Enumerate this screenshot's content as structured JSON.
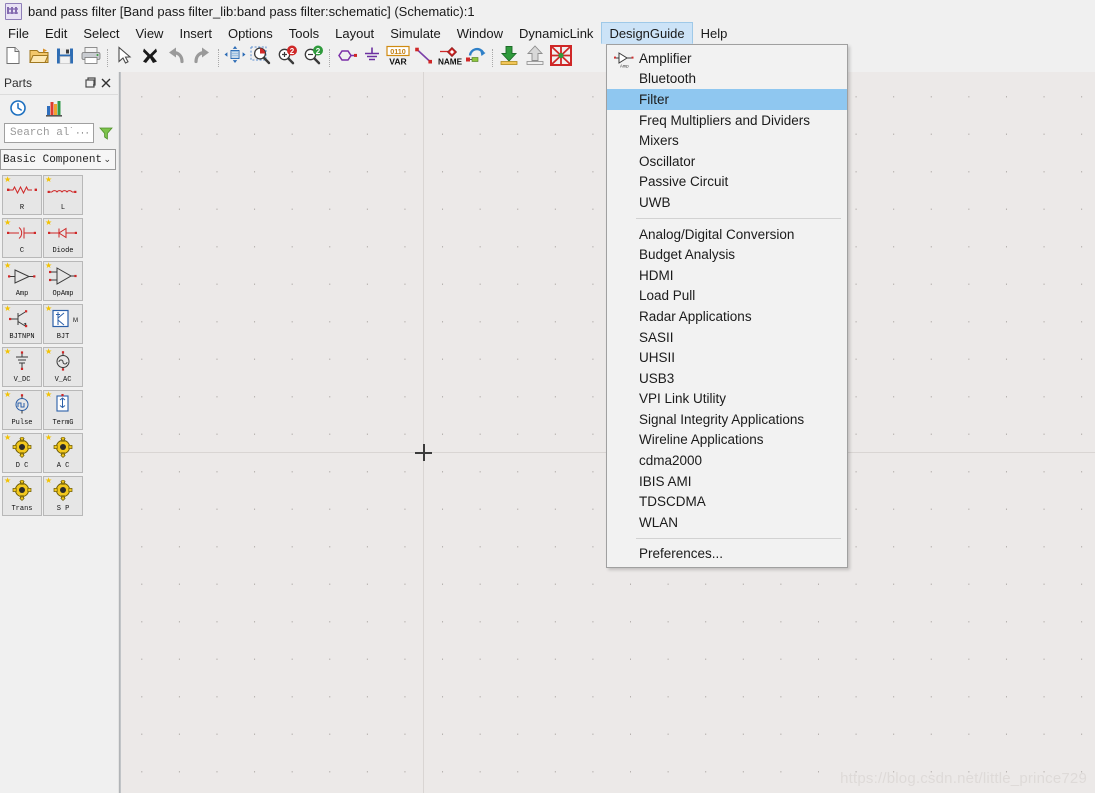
{
  "window": {
    "title": "band pass filter [Band pass filter_lib:band pass filter:schematic] (Schematic):1",
    "app_icon": "schematic-app-icon"
  },
  "menubar": {
    "items": [
      {
        "label": "File",
        "active": false
      },
      {
        "label": "Edit",
        "active": false
      },
      {
        "label": "Select",
        "active": false
      },
      {
        "label": "View",
        "active": false
      },
      {
        "label": "Insert",
        "active": false
      },
      {
        "label": "Options",
        "active": false
      },
      {
        "label": "Tools",
        "active": false
      },
      {
        "label": "Layout",
        "active": false
      },
      {
        "label": "Simulate",
        "active": false
      },
      {
        "label": "Window",
        "active": false
      },
      {
        "label": "DynamicLink",
        "active": false
      },
      {
        "label": "DesignGuide",
        "active": true
      },
      {
        "label": "Help",
        "active": false
      }
    ],
    "highlight_color": "#cce3f7"
  },
  "toolbar": {
    "buttons": [
      {
        "name": "new-file-icon",
        "title": "New"
      },
      {
        "name": "open-folder-icon",
        "title": "Open"
      },
      {
        "name": "save-icon",
        "title": "Save"
      },
      {
        "name": "print-icon",
        "title": "Print"
      },
      {
        "name": "separator",
        "title": ""
      },
      {
        "name": "select-arrow-icon",
        "title": "Select"
      },
      {
        "name": "delete-x-icon",
        "title": "Delete"
      },
      {
        "name": "undo-icon",
        "title": "Undo"
      },
      {
        "name": "redo-icon",
        "title": "Redo"
      },
      {
        "name": "separator",
        "title": ""
      },
      {
        "name": "pan-move-icon",
        "title": "Pan"
      },
      {
        "name": "zoom-area-icon",
        "title": "Zoom Area"
      },
      {
        "name": "zoom-in-icon",
        "title": "Zoom In"
      },
      {
        "name": "zoom-out-icon",
        "title": "Zoom Out"
      },
      {
        "name": "separator",
        "title": ""
      },
      {
        "name": "port-pin-icon",
        "title": "Insert Port"
      },
      {
        "name": "ground-icon",
        "title": "Insert Ground"
      },
      {
        "name": "var-eqn-icon",
        "title": "VAR Equation"
      },
      {
        "name": "wire-icon",
        "title": "Insert Wire"
      },
      {
        "name": "wire-name-icon",
        "title": "Wire/Pin Label"
      },
      {
        "name": "wire-label-rotate-icon",
        "title": "Insert Wire Label"
      },
      {
        "name": "separator",
        "title": ""
      },
      {
        "name": "push-into-hierarchy-icon",
        "title": "Push Into Hierarchy"
      },
      {
        "name": "pop-out-hierarchy-icon",
        "title": "Pop Out"
      },
      {
        "name": "simulate-icon",
        "title": "Simulate"
      }
    ],
    "var_label": "VAR",
    "var_bits": "0110",
    "name_label": "NAME"
  },
  "parts_panel": {
    "title": "Parts",
    "header_buttons": [
      {
        "name": "undock-icon",
        "label": "❐"
      },
      {
        "name": "close-icon",
        "label": "✕"
      }
    ],
    "tool_buttons": [
      {
        "name": "history-clock-icon"
      },
      {
        "name": "library-chart-icon"
      }
    ],
    "search": {
      "placeholder": "Search all",
      "value": "",
      "dots": "···",
      "filter_icon": "funnel-filter-icon"
    },
    "category": {
      "value": "Basic Components",
      "arrow": "⌄"
    },
    "components": [
      {
        "label": "R",
        "sym": "resistor"
      },
      {
        "label": "L",
        "sym": "inductor"
      },
      {
        "label": "C",
        "sym": "capacitor"
      },
      {
        "label": "Diode",
        "sym": "diode"
      },
      {
        "label": "Amp",
        "sym": "amp"
      },
      {
        "label": "OpAmp",
        "sym": "opamp"
      },
      {
        "label": "BJTNPN",
        "sym": "bjtnpn"
      },
      {
        "label": "BJT",
        "sym": "bjt-box"
      },
      {
        "label": "V_DC",
        "sym": "vdc"
      },
      {
        "label": "V_AC",
        "sym": "vac"
      },
      {
        "label": "Pulse",
        "sym": "pulse"
      },
      {
        "label": "TermG",
        "sym": "termg"
      },
      {
        "label": "D C",
        "sym": "gear"
      },
      {
        "label": "A C",
        "sym": "gear"
      },
      {
        "label": "Trans",
        "sym": "gear"
      },
      {
        "label": "S P",
        "sym": "gear"
      }
    ]
  },
  "design_guide_menu": {
    "gutter_icon": "amplifier-icon",
    "groups": [
      {
        "items": [
          {
            "label": "Amplifier",
            "selected": false
          },
          {
            "label": "Bluetooth",
            "selected": false
          },
          {
            "label": "Filter",
            "selected": true
          },
          {
            "label": "Freq Multipliers and Dividers",
            "selected": false
          },
          {
            "label": "Mixers",
            "selected": false
          },
          {
            "label": "Oscillator",
            "selected": false
          },
          {
            "label": "Passive Circuit",
            "selected": false
          },
          {
            "label": "UWB",
            "selected": false
          }
        ]
      },
      {
        "items": [
          {
            "label": "Analog/Digital Conversion",
            "selected": false
          },
          {
            "label": "Budget Analysis",
            "selected": false
          },
          {
            "label": "HDMI",
            "selected": false
          },
          {
            "label": "Load Pull",
            "selected": false
          },
          {
            "label": "Radar Applications",
            "selected": false
          },
          {
            "label": "SASII",
            "selected": false
          },
          {
            "label": "UHSII",
            "selected": false
          },
          {
            "label": "USB3",
            "selected": false
          },
          {
            "label": "VPI Link Utility",
            "selected": false
          },
          {
            "label": "Signal Integrity Applications",
            "selected": false
          },
          {
            "label": "Wireline Applications",
            "selected": false
          },
          {
            "label": "cdma2000",
            "selected": false
          },
          {
            "label": "IBIS AMI",
            "selected": false
          },
          {
            "label": "TDSCDMA",
            "selected": false
          },
          {
            "label": "WLAN",
            "selected": false
          }
        ]
      },
      {
        "items": [
          {
            "label": "Preferences...",
            "selected": false
          }
        ]
      }
    ],
    "selection_color": "#8fc7f0"
  },
  "canvas": {
    "watermark": "https://blog.csdn.net/little_prince729",
    "background": "#ece9e8",
    "origin_marker": "origin-crosshair"
  }
}
